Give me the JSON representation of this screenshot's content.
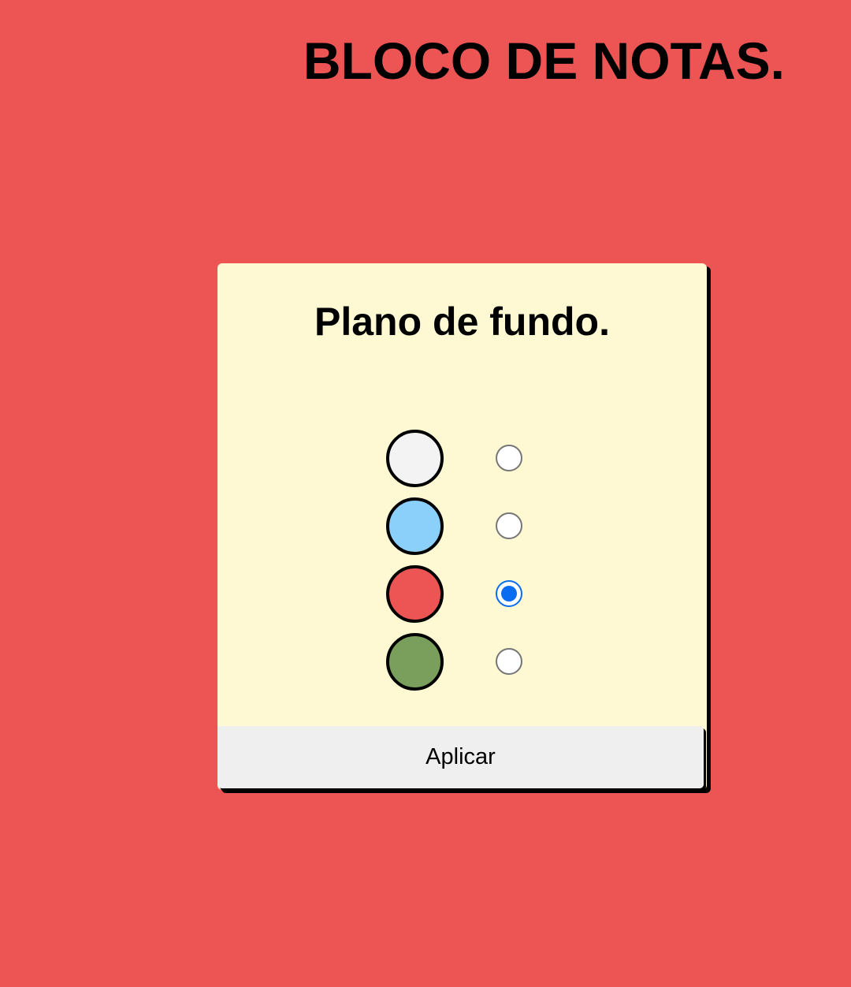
{
  "app": {
    "title": "BLOCO DE NOTAS."
  },
  "dialog": {
    "title": "Plano de fundo.",
    "apply_label": "Aplicar",
    "options": [
      {
        "color": "#f3f3f3",
        "selected": false
      },
      {
        "color": "#8bd0fb",
        "selected": false
      },
      {
        "color": "#ed5454",
        "selected": true
      },
      {
        "color": "#7a9f5c",
        "selected": false
      }
    ]
  },
  "colors": {
    "page_background": "#ed5454",
    "dialog_background": "#fef9d2",
    "button_background": "#efefef",
    "radio_accent": "#0a6cf0"
  }
}
